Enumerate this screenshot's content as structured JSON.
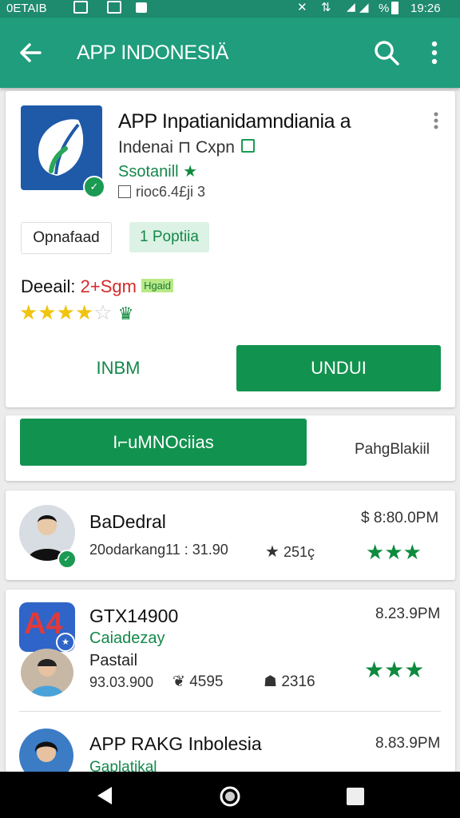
{
  "status_bar": {
    "left_text": "0ETAIB",
    "time": "19:26",
    "battery": "%"
  },
  "app_bar": {
    "title": "APP INDONESIÄ"
  },
  "app_card": {
    "title": "APP Inpatianidamndiania  a",
    "developer": "Indenai ⊓ Cxpn",
    "category": "Ssotanill",
    "meta": "rioc6.4£ji 3",
    "chip_left": "Opnafaad",
    "chip_right": "1 Poptiia",
    "detail_label": "Deeail:",
    "detail_value": "2+Sgm",
    "detail_tag": "Hgaid",
    "rating_stars": 4,
    "button_secondary": "INBM",
    "button_primary": "UNDUI"
  },
  "action_bar": {
    "primary": "I⌐uMNOciias",
    "secondary": "PahgBlakiil"
  },
  "list": [
    {
      "name": "BaDedral",
      "sub": "20odarkang11 : 31.90",
      "count": "251ç",
      "price": "$ 8:80.0PM"
    },
    {
      "name": "GTX14900",
      "sub": "Caiadezay",
      "sub2": "Pastail",
      "meta": "93.03.900",
      "count_a": "4595",
      "count_b": "2316",
      "price": "8.23.9PM"
    },
    {
      "name": "APP RAKG Inbolesia",
      "sub": "Gaplatikal",
      "price": "8.83.9PM"
    }
  ],
  "colors": {
    "primary": "#1f9d7c",
    "button": "#12924f",
    "star": "#f1c40f",
    "green_star": "#0e8a3e",
    "red": "#d62a2a"
  }
}
